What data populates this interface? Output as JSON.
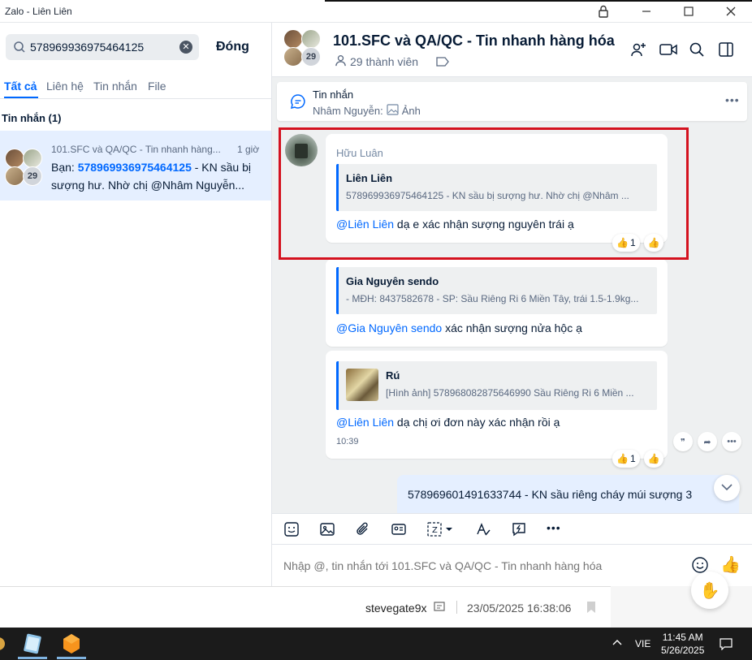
{
  "window": {
    "title": "Zalo - Liên Liên"
  },
  "search": {
    "value": "578969936975464125",
    "close_label": "Đóng"
  },
  "tabs": [
    "Tất cả",
    "Liên hệ",
    "Tin nhắn",
    "File"
  ],
  "results": {
    "section_label": "Tin nhắn (1)",
    "item": {
      "title": "101.SFC và QA/QC - Tin nhanh hàng...",
      "time": "1 giờ",
      "prefix": "Bạn: ",
      "match": "578969936975464125",
      "rest": " - KN sầu bị",
      "line2": "sượng hư. Nhờ chị @Nhâm Nguyễn...",
      "member_badge": "29"
    }
  },
  "chat": {
    "title": "101.SFC và QA/QC - Tin nhanh hàng hóa",
    "members": "29 thành viên",
    "member_badge": "29",
    "pinned": {
      "title": "Tin nhắn",
      "sender": "Nhâm Nguyễn:",
      "content": "Ảnh"
    },
    "messages": [
      {
        "sender": "Hữu Luân",
        "quote_name": "Liên Liên",
        "quote_text": "578969936975464125 - KN sầu bị sượng hư. Nhờ chị @Nhâm ...",
        "mention": "@Liên Liên",
        "text": " dạ e xác nhận sượng nguyên trái ạ",
        "reaction_count": "1"
      },
      {
        "quote_name": "Gia Nguyên sendo",
        "quote_text": "- MĐH: 8437582678 - SP: Sầu Riêng Ri 6 Miền Tây, trái 1.5-1.9kg...",
        "mention": "@Gia Nguyên sendo",
        "text": " xác nhận sượng nửa hộc ạ"
      },
      {
        "quote_name": "Rú",
        "quote_text": "[Hình ảnh] 578968082875646990 Sầu Riêng Ri 6 Miền ...",
        "mention": "@Liên Liên",
        "text": " dạ chị ơi đơn này xác nhận rồi ạ",
        "time": "10:39",
        "reaction_count": "1"
      }
    ],
    "own_message": "578969601491633744 - KN sầu riêng cháy múi sượng 3"
  },
  "composer": {
    "placeholder": "Nhập @, tin nhắn tới 101.SFC và QA/QC - Tin nhanh hàng hóa"
  },
  "background": {
    "user": "stevegate9x",
    "timestamp": "23/05/2025 16:38:06"
  },
  "taskbar": {
    "lang": "VIE",
    "time": "11:45 AM",
    "date": "5/26/2025"
  },
  "colors": {
    "accent": "#0068ff",
    "highlight_box": "#d4121f",
    "chat_bg": "#eef0f1",
    "own_bubble": "#e5efff"
  }
}
